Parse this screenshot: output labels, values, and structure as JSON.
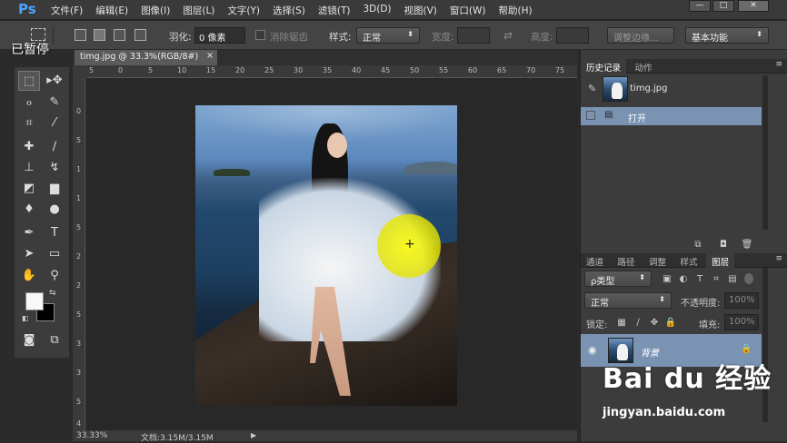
{
  "app": {
    "logo": "Ps"
  },
  "menu": [
    "文件(F)",
    "编辑(E)",
    "图像(I)",
    "图层(L)",
    "文字(Y)",
    "选择(S)",
    "滤镜(T)",
    "3D(D)",
    "视图(V)",
    "窗口(W)",
    "帮助(H)"
  ],
  "window_buttons": {
    "minimize": "—",
    "restore": "□",
    "close": "✕"
  },
  "overlay": {
    "paused": "已暂停"
  },
  "options": {
    "feather_label": "羽化:",
    "feather_value": "0 像素",
    "antialias_label": "消除锯齿",
    "style_label": "样式:",
    "style_value": "正常",
    "width_label": "宽度:",
    "height_label": "高度:",
    "refine_edge": "调整边缘...",
    "workspace": "基本功能"
  },
  "document": {
    "tab_title": "timg.jpg @ 33.3%(RGB/8#)",
    "tab_close": "×",
    "zoom": "33.33%",
    "doc_size": "文档:3.15M/3.15M"
  },
  "ruler": {
    "h_ticks": [
      "5",
      "0",
      "5",
      "10",
      "15",
      "20",
      "25",
      "30",
      "35",
      "40",
      "45",
      "50",
      "55",
      "60",
      "65",
      "70",
      "75"
    ],
    "v_ticks": [
      "0",
      "5",
      "1",
      "1",
      "5",
      "2",
      "2",
      "5",
      "3",
      "3",
      "5",
      "4"
    ]
  },
  "history_panel": {
    "tabs": [
      "历史记录",
      "动作"
    ],
    "snapshot_label": "timg.jpg",
    "items": [
      "打开"
    ]
  },
  "layers_panel": {
    "tabs": [
      "通道",
      "路径",
      "调整",
      "样式",
      "图层"
    ],
    "kind_filter": "ρ类型",
    "blend_mode": "正常",
    "opacity_label": "不透明度:",
    "opacity_value": "100%",
    "lock_label": "锁定:",
    "fill_label": "填充:",
    "fill_value": "100%",
    "layer_name": "背景"
  },
  "watermark": {
    "brand": "Bai du 经验",
    "url": "jingyan.baidu.com"
  }
}
